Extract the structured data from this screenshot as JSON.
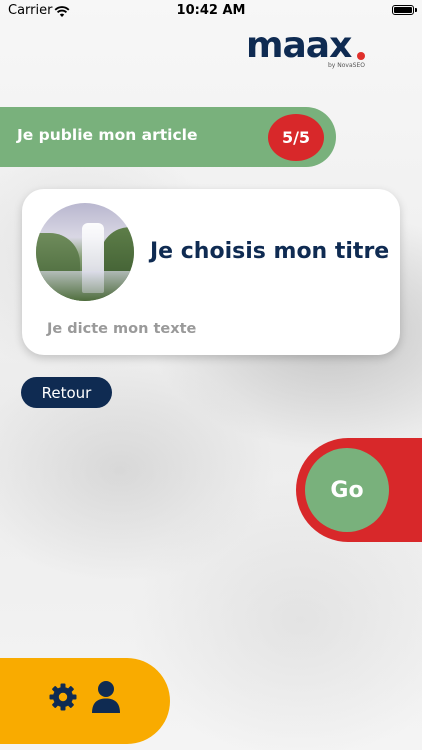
{
  "status_bar": {
    "carrier": "Carrier",
    "time": "10:42 AM",
    "wifi_icon": "wifi-icon",
    "battery_icon": "battery-icon"
  },
  "logo": {
    "wordmark": "maax",
    "tagline": "by NovaSEO"
  },
  "header": {
    "title": "Je publie mon article",
    "step_counter": "5/5"
  },
  "card": {
    "image_icon": "waterfall-thumbnail",
    "title": "Je choisis mon titre",
    "text_placeholder": "Je dicte mon texte"
  },
  "actions": {
    "back_label": "Retour",
    "go_label": "Go"
  },
  "bottom_nav": {
    "settings_icon": "gear-icon",
    "profile_icon": "user-icon"
  },
  "colors": {
    "navy": "#0f2b52",
    "green": "#79b17c",
    "red": "#d8282a",
    "orange": "#f9ab00"
  }
}
